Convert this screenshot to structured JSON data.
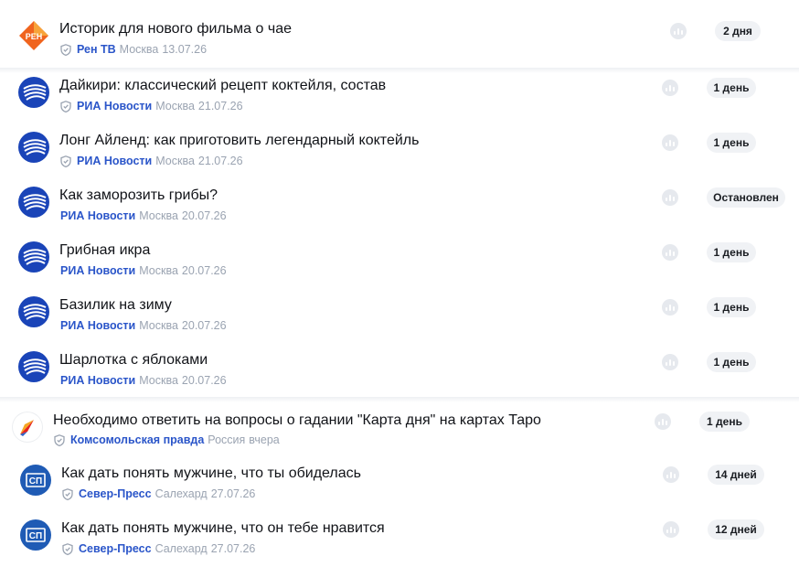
{
  "items": [
    {
      "title": "Историк для нового фильма о чае",
      "source": "Рен ТВ",
      "city": "Москва",
      "date": "13.07.26",
      "badge": "2 дня",
      "logo_icon": "ren-tv-logo-icon",
      "verified": true
    },
    {
      "title": "Дайкири: классический рецепт коктейля, состав",
      "source": "РИА Новости",
      "city": "Москва",
      "date": "21.07.26",
      "badge": "1 день",
      "logo_icon": "ria-novosti-logo-icon",
      "verified": true
    },
    {
      "title": "Лонг Айленд: как приготовить легендарный коктейль",
      "source": "РИА Новости",
      "city": "Москва",
      "date": "21.07.26",
      "badge": "1 день",
      "logo_icon": "ria-novosti-logo-icon",
      "verified": true
    },
    {
      "title": "Как заморозить грибы?",
      "source": "РИА Новости",
      "city": "Москва",
      "date": "20.07.26",
      "badge": "Остановлен",
      "logo_icon": "ria-novosti-logo-icon",
      "verified": false
    },
    {
      "title": "Грибная икра",
      "source": "РИА Новости",
      "city": "Москва",
      "date": "20.07.26",
      "badge": "1 день",
      "logo_icon": "ria-novosti-logo-icon",
      "verified": false
    },
    {
      "title": "Базилик на зиму",
      "source": "РИА Новости",
      "city": "Москва",
      "date": "20.07.26",
      "badge": "1 день",
      "logo_icon": "ria-novosti-logo-icon",
      "verified": false
    },
    {
      "title": "Шарлотка с яблоками",
      "source": "РИА Новости",
      "city": "Москва",
      "date": "20.07.26",
      "badge": "1 день",
      "logo_icon": "ria-novosti-logo-icon",
      "verified": false
    },
    {
      "title": "Необходимо ответить на вопросы о гадании \"Карта дня\" на картах Таро",
      "source": "Комсомольская правда",
      "city": "Россия",
      "date": "вчера",
      "badge": "1 день",
      "logo_icon": "komsomolskaya-pravda-logo-icon",
      "verified": true
    },
    {
      "title": "Как дать понять мужчине, что ты обиделась",
      "source": "Север-Пресс",
      "city": "Салехард",
      "date": "27.07.26",
      "badge": "14 дней",
      "logo_icon": "sever-press-logo-icon",
      "verified": true
    },
    {
      "title": "Как дать понять мужчине, что он тебе нравится",
      "source": "Север-Пресс",
      "city": "Салехард",
      "date": "27.07.26",
      "badge": "12 дней",
      "logo_icon": "sever-press-logo-icon",
      "verified": true
    }
  ],
  "logos": {
    "ren_tv_text": "РЕН",
    "sever_press_text": "СП"
  },
  "colors": {
    "source_link": "#2a55c9",
    "meta_text": "#9aa3b1",
    "badge_bg": "#f0f2f5",
    "ria_blue": "#1a44b8",
    "ren_orange": "#f0641e",
    "sever_blue": "#1f5bb5"
  },
  "stats_icon": "bar-chart-icon",
  "verified_icon": "shield-check-icon"
}
